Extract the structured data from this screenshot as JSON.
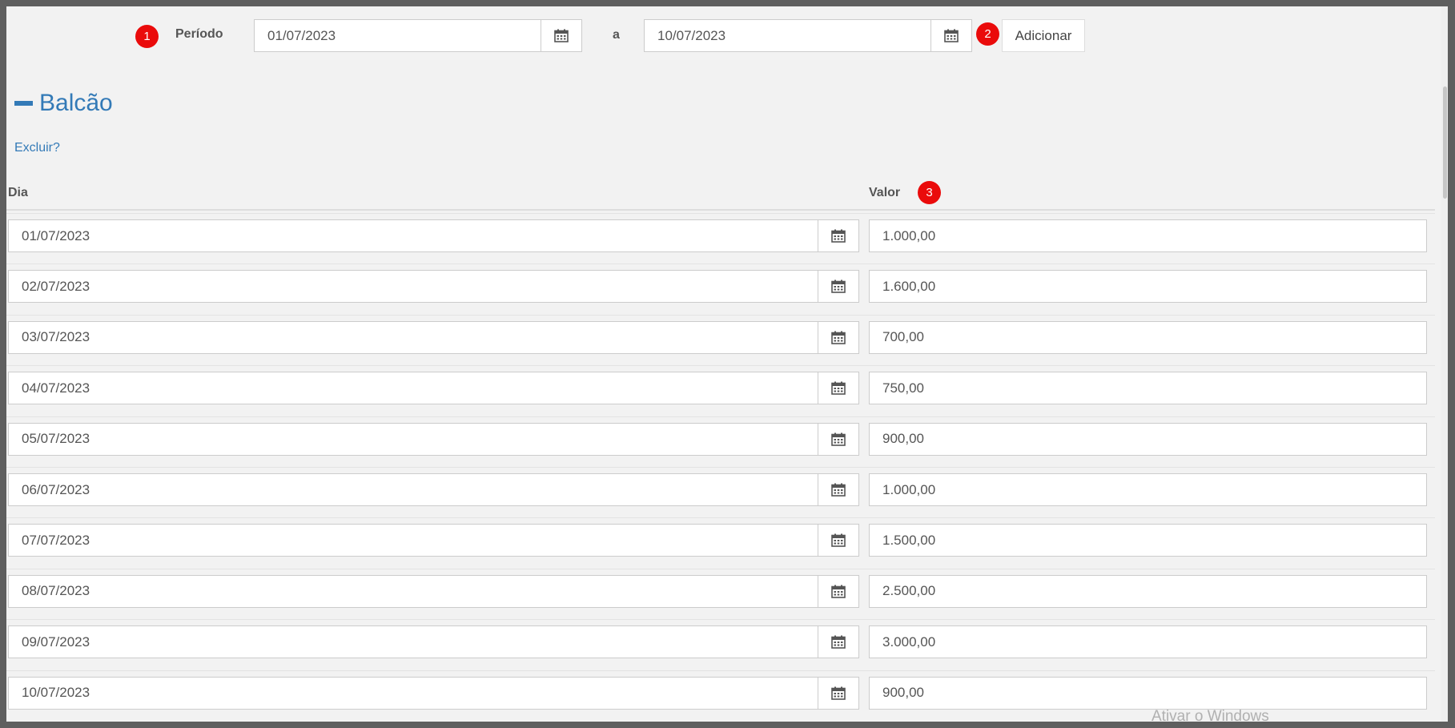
{
  "markers": [
    "1",
    "2",
    "3"
  ],
  "period": {
    "label": "Período",
    "start": "01/07/2023",
    "separator": "a",
    "end": "10/07/2023",
    "add_label": "Adicionar"
  },
  "section": {
    "title": "Balcão",
    "delete_link": "Excluir?"
  },
  "table": {
    "headers": {
      "day": "Dia",
      "value": "Valor"
    },
    "rows": [
      {
        "day": "01/07/2023",
        "value": "1.000,00"
      },
      {
        "day": "02/07/2023",
        "value": "1.600,00"
      },
      {
        "day": "03/07/2023",
        "value": "700,00"
      },
      {
        "day": "04/07/2023",
        "value": "750,00"
      },
      {
        "day": "05/07/2023",
        "value": "900,00"
      },
      {
        "day": "06/07/2023",
        "value": "1.000,00"
      },
      {
        "day": "07/07/2023",
        "value": "1.500,00"
      },
      {
        "day": "08/07/2023",
        "value": "2.500,00"
      },
      {
        "day": "09/07/2023",
        "value": "3.000,00"
      },
      {
        "day": "10/07/2023",
        "value": "900,00"
      }
    ]
  },
  "watermark": "Ativar o Windows",
  "icons": {
    "calendar": "calendar-icon",
    "collapse": "minus-icon"
  },
  "colors": {
    "accent": "#337ab7",
    "marker": "#ea0b0b",
    "background": "#f2f2f2"
  }
}
